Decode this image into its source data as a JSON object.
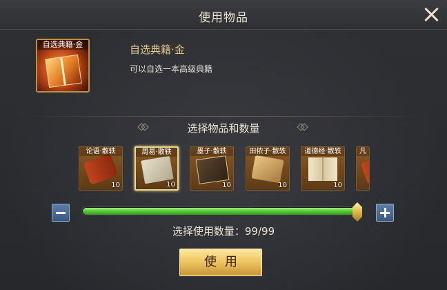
{
  "dialog": {
    "title": "使用物品"
  },
  "item": {
    "tag": "自选典籍·金",
    "name": "自选典籍·金",
    "description": "可以自选一本高级典籍"
  },
  "section": {
    "title": "选择物品和数量"
  },
  "choices": [
    {
      "label": "论语·散轶",
      "count": "10",
      "icon": "scroll-icon",
      "selected": false
    },
    {
      "label": "周易·散轶",
      "count": "10",
      "icon": "book-icon",
      "selected": true
    },
    {
      "label": "墨子·散轶",
      "count": "10",
      "icon": "plaque-icon",
      "selected": false
    },
    {
      "label": "田侬子·散轶",
      "count": "10",
      "icon": "bundle-icon",
      "selected": false
    },
    {
      "label": "道德经·散轶",
      "count": "10",
      "icon": "open-book-icon",
      "selected": false
    },
    {
      "label": "凡",
      "count": "",
      "icon": "scroll-icon",
      "selected": false
    }
  ],
  "quantity": {
    "label": "选择使用数量：",
    "value_text": "99/99",
    "fraction": 1.0,
    "minus": "−",
    "plus": "+"
  },
  "use_button": {
    "label": "使用"
  },
  "colors": {
    "accent_gold": "#e6c98a",
    "slider_green": "#54c43a",
    "button_blue": "#3a5a80"
  }
}
